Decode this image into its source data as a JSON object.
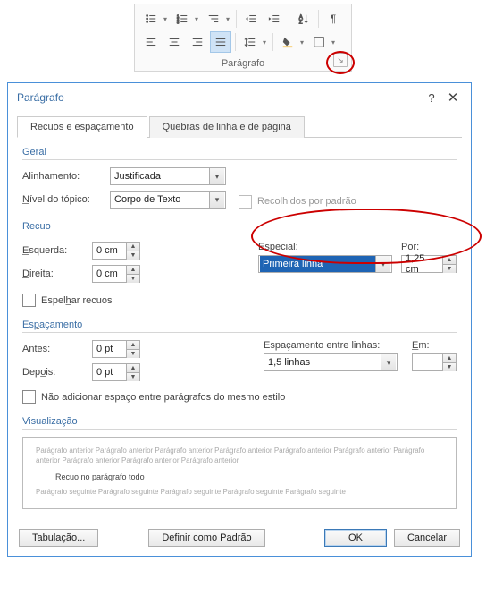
{
  "ribbon": {
    "group_label": "Parágrafo"
  },
  "dialog": {
    "title": "Parágrafo",
    "tabs": {
      "spacing": "Recuos e espaçamento",
      "breaks": "Quebras de linha e de página"
    },
    "geral": {
      "title": "Geral",
      "alignment_label": "Alinhamento:",
      "alignment_value": "Justificada",
      "outline_label": "Nível do tópico:",
      "outline_value": "Corpo de Texto",
      "collapsed_label": "Recolhidos por padrão"
    },
    "recuo": {
      "title": "Recuo",
      "left_label": "Esquerda:",
      "left_value": "0 cm",
      "right_label": "Direita:",
      "right_value": "0 cm",
      "special_label": "Especial:",
      "special_value": "Primeira linha",
      "by_label": "Por:",
      "by_value": "1,25 cm",
      "mirror_label": "Espelhar recuos"
    },
    "espac": {
      "title": "Espaçamento",
      "before_label": "Antes:",
      "before_value": "0 pt",
      "after_label": "Depois:",
      "after_value": "0 pt",
      "line_label": "Espaçamento entre linhas:",
      "line_value": "1,5 linhas",
      "at_label": "Em:",
      "at_value": "",
      "noadd_label": "Não adicionar espaço entre parágrafos do mesmo estilo"
    },
    "preview": {
      "title": "Visualização",
      "grey_before": "Parágrafo anterior Parágrafo anterior Parágrafo anterior Parágrafo anterior Parágrafo anterior Parágrafo anterior Parágrafo anterior Parágrafo anterior Parágrafo anterior Parágrafo anterior",
      "sample": "Recuo no parágrafo todo",
      "grey_after": "Parágrafo seguinte Parágrafo seguinte Parágrafo seguinte Parágrafo seguinte Parágrafo seguinte"
    },
    "buttons": {
      "tabs": "Tabulação...",
      "default": "Definir como Padrão",
      "ok": "OK",
      "cancel": "Cancelar"
    }
  }
}
